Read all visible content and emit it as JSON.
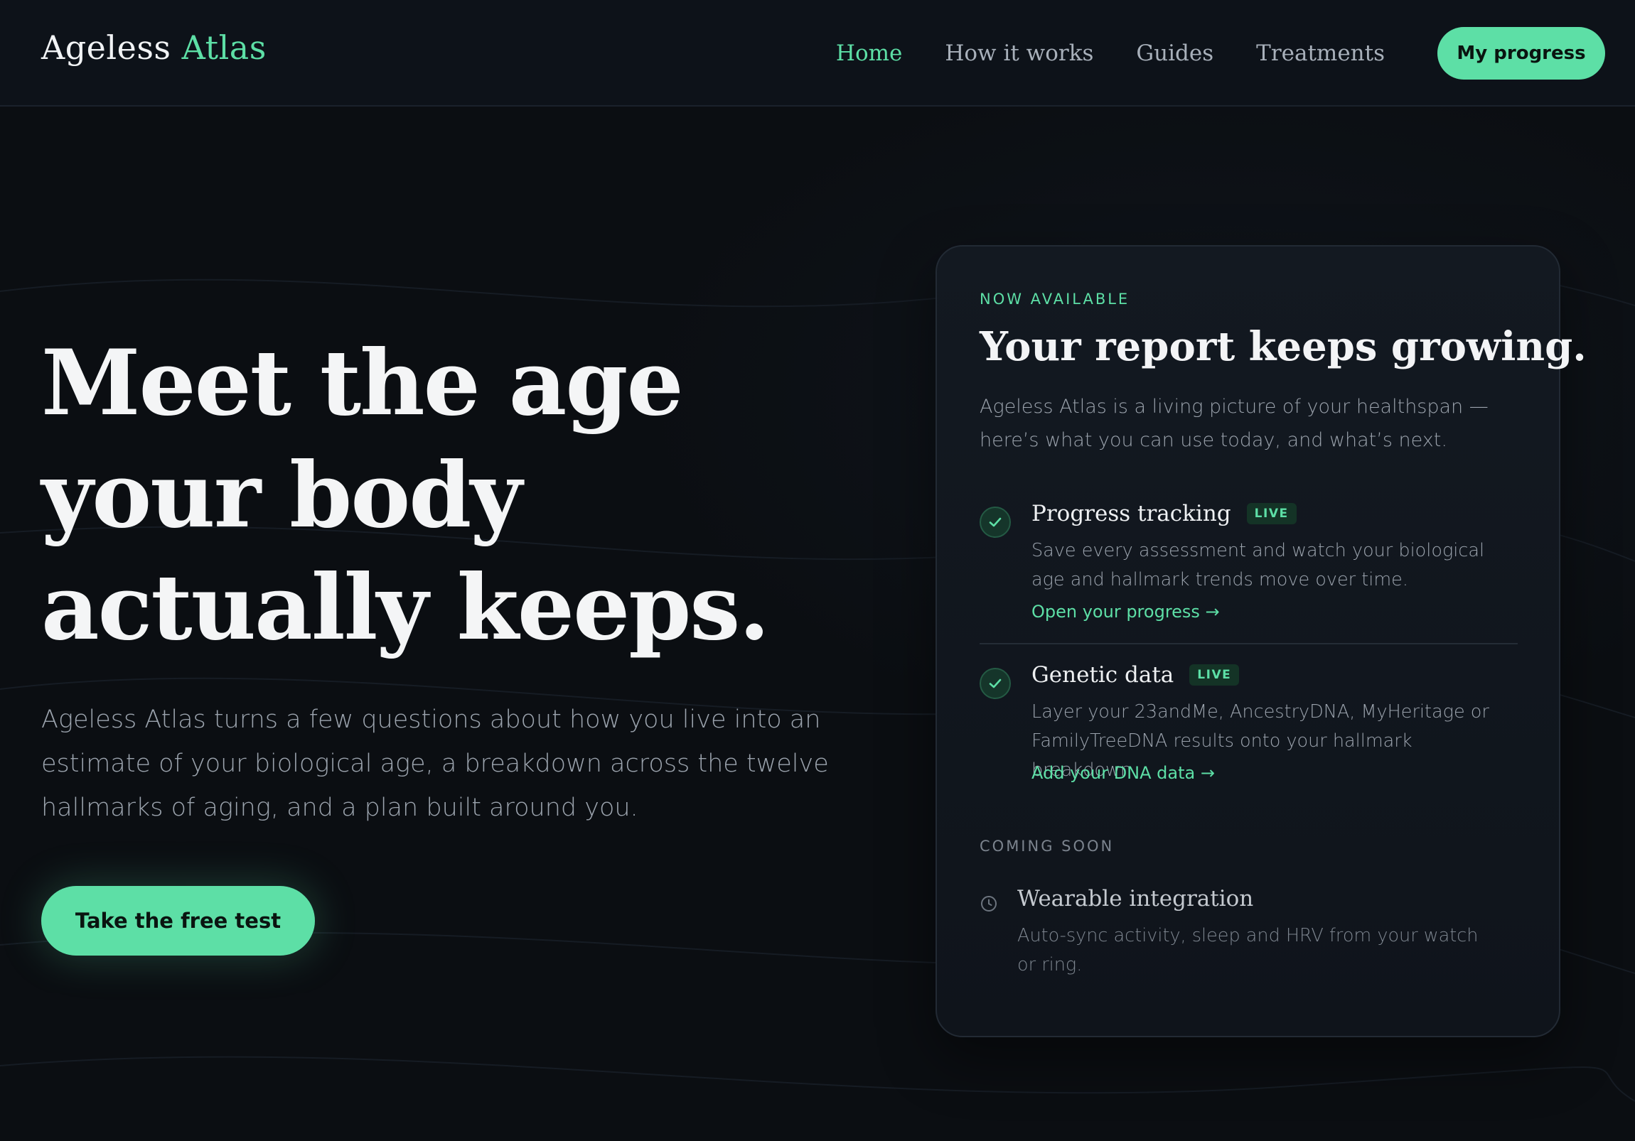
{
  "header": {
    "logo_primary": "Ageless",
    "logo_accent": "Atlas",
    "nav": [
      {
        "label": "Home",
        "active": true
      },
      {
        "label": "How it works",
        "active": false
      },
      {
        "label": "Guides",
        "active": false
      },
      {
        "label": "Treatments",
        "active": false
      }
    ],
    "cta_label": "My progress"
  },
  "hero": {
    "title_line1": "Meet the age",
    "title_line2": "your body",
    "title_line3": "actually keeps.",
    "subtitle": "Ageless Atlas turns a few questions about how you live into an estimate of your biological age, a breakdown across the twelve hallmarks of aging, and a plan built around you.",
    "cta_label": "Take the free test"
  },
  "card": {
    "eyebrow_available": "NOW AVAILABLE",
    "title": "Your report keeps growing.",
    "description": "Ageless Atlas is a living picture of your healthspan — here’s what you can use today, and what’s next.",
    "features": [
      {
        "name": "Progress tracking",
        "badge": "LIVE",
        "description": "Save every assessment and watch your biological age and hallmark trends move over time.",
        "link": "Open your progress →",
        "icon": "check-icon"
      },
      {
        "name": "Genetic data",
        "badge": "LIVE",
        "description": "Layer your 23andMe, AncestryDNA, MyHeritage or FamilyTreeDNA results onto your hallmark breakdown.",
        "link": "Add your DNA data →",
        "icon": "check-icon"
      }
    ],
    "eyebrow_soon": "COMING SOON",
    "upcoming": {
      "name": "Wearable integration",
      "description": "Auto-sync activity, sleep and HRV from your watch or ring.",
      "icon": "clock-icon"
    }
  },
  "colors": {
    "accent": "#5ddfa6",
    "background": "#0b0e12",
    "card": "#131921"
  }
}
